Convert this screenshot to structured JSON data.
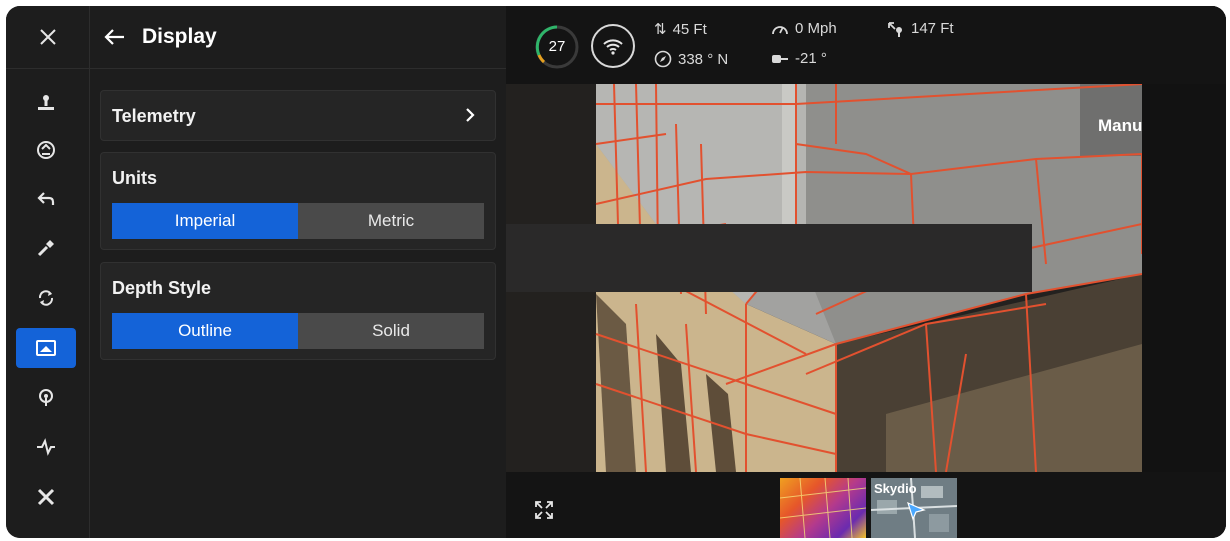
{
  "panel": {
    "title": "Display",
    "telemetry_label": "Telemetry",
    "units": {
      "title": "Units",
      "options": [
        "Imperial",
        "Metric"
      ],
      "selected": "Imperial"
    },
    "depth_style": {
      "title": "Depth Style",
      "options": [
        "Outline",
        "Solid"
      ],
      "selected": "Outline"
    }
  },
  "rail": {
    "icons": [
      "close-icon",
      "takeoff-icon",
      "launch-icon",
      "return-icon",
      "flashlight-icon",
      "rotate-icon",
      "display-icon",
      "signal-icon",
      "activity-icon",
      "tools-icon"
    ],
    "active": "display-icon"
  },
  "topbar": {
    "battery": "27",
    "altitude": "45 Ft",
    "heading": "338 ° N",
    "speed": "0 Mph",
    "pitch": "-21 °",
    "distance": "147 Ft"
  },
  "camera": {
    "mode": "Manual"
  },
  "minimap": {
    "brand": "Skydio"
  },
  "colors": {
    "accent": "#1463d8",
    "grid": "#e2512f"
  }
}
